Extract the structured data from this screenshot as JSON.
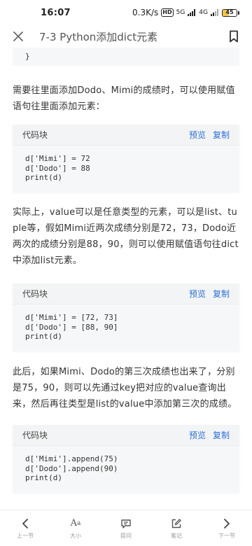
{
  "status_bar": {
    "time": "16:07",
    "speed": "0.3K/s",
    "hd": "HD",
    "signal1": "5G",
    "signal2": "4G",
    "battery": "45"
  },
  "header": {
    "title": "7-3 Python添加dict元素"
  },
  "top_code": {
    "line": "}"
  },
  "paragraphs": {
    "p1": "需要往里面添加Dodo、Mimi的成绩时，可以使用赋值语句往里面添加元素：",
    "p2": "实际上，value可以是任意类型的元素，可以是list、tuple等，假如Mimi近两次成绩分别是72，73，Dodo近两次的成绩分别是88，90，则可以使用赋值语句往dict中添加list元素。",
    "p3": "此后，如果Mimi、Dodo的第三次成绩也出来了，分别是75，90，则可以先通过key把对应的value查询出来，然后再往类型是list的value中添加第三次的成绩。"
  },
  "code_blocks": [
    {
      "label": "代码块",
      "preview": "预览",
      "copy": "复制",
      "lines": [
        "d['Mimi'] = 72",
        "d['Dodo'] = 88",
        "print(d)"
      ]
    },
    {
      "label": "代码块",
      "preview": "预览",
      "copy": "复制",
      "lines": [
        "d['Mimi'] = [72, 73]",
        "d['Dodo'] = [88, 90]",
        "print(d)"
      ]
    },
    {
      "label": "代码块",
      "preview": "预览",
      "copy": "复制",
      "lines": [
        "d['Mimi'].append(75)",
        "d['Dodo'].append(90)",
        "print(d)"
      ]
    }
  ],
  "bottom_nav": {
    "prev": "上一节",
    "font": "大小",
    "question": "提问",
    "note": "笔记",
    "next": "下一节"
  },
  "colors": {
    "accent": "#2d6fd6",
    "battery": "#f3c64a"
  }
}
